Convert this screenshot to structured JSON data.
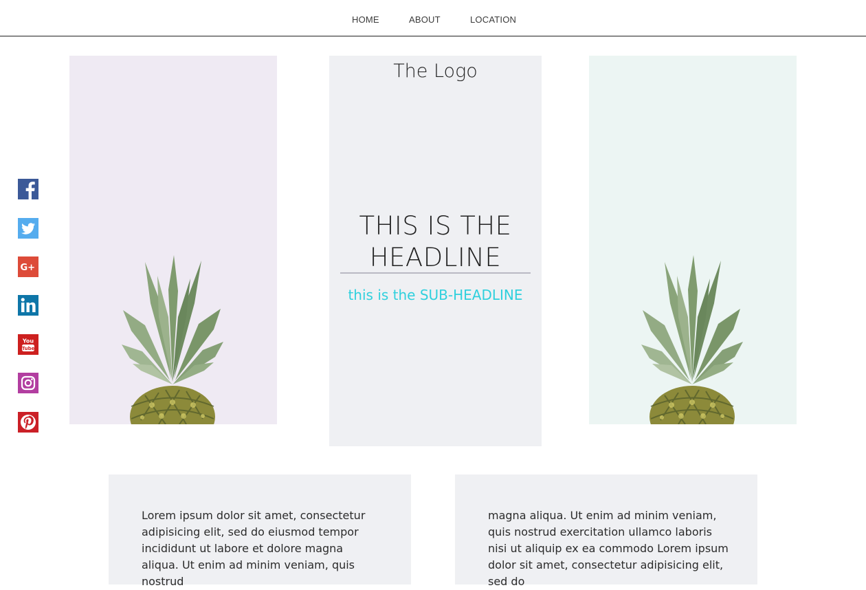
{
  "nav": {
    "items": [
      {
        "label": "HOME"
      },
      {
        "label": "ABOUT"
      },
      {
        "label": "LOCATION"
      }
    ]
  },
  "hero": {
    "logo": "The Logo",
    "headline": "THIS IS THE HEADLINE",
    "subheadline": "this is the SUB-HEADLINE"
  },
  "social": {
    "icons": [
      "facebook-icon",
      "twitter-icon",
      "google-plus-icon",
      "linkedin-icon",
      "youtube-icon",
      "instagram-icon",
      "pinterest-icon"
    ],
    "youtube_text_top": "You",
    "youtube_text_bottom": "Tube"
  },
  "cards": [
    {
      "text": "Lorem ipsum dolor sit amet, consectetur adipisicing elit, sed do eiusmod tempor incididunt ut labore et dolore magna aliqua. Ut enim ad minim veniam, quis nostrud"
    },
    {
      "text": "magna aliqua. Ut enim ad minim veniam, quis nostrud exercitation ullamco laboris nisi ut aliquip ex ea commodo Lorem ipsum dolor sit amet, consectetur adipisicing elit, sed do"
    }
  ],
  "colors": {
    "subheadline": "#2fd0dd",
    "panel_left_bg": "#efeaf3",
    "panel_center_bg": "#eff0f3",
    "panel_right_bg": "#ecf5f3",
    "facebook": "#3b5998",
    "twitter": "#55acee",
    "google_plus": "#dd4b39",
    "linkedin": "#0e76a8",
    "youtube": "#cd201f",
    "instagram": "#b23ea0",
    "pinterest": "#cb2027"
  }
}
